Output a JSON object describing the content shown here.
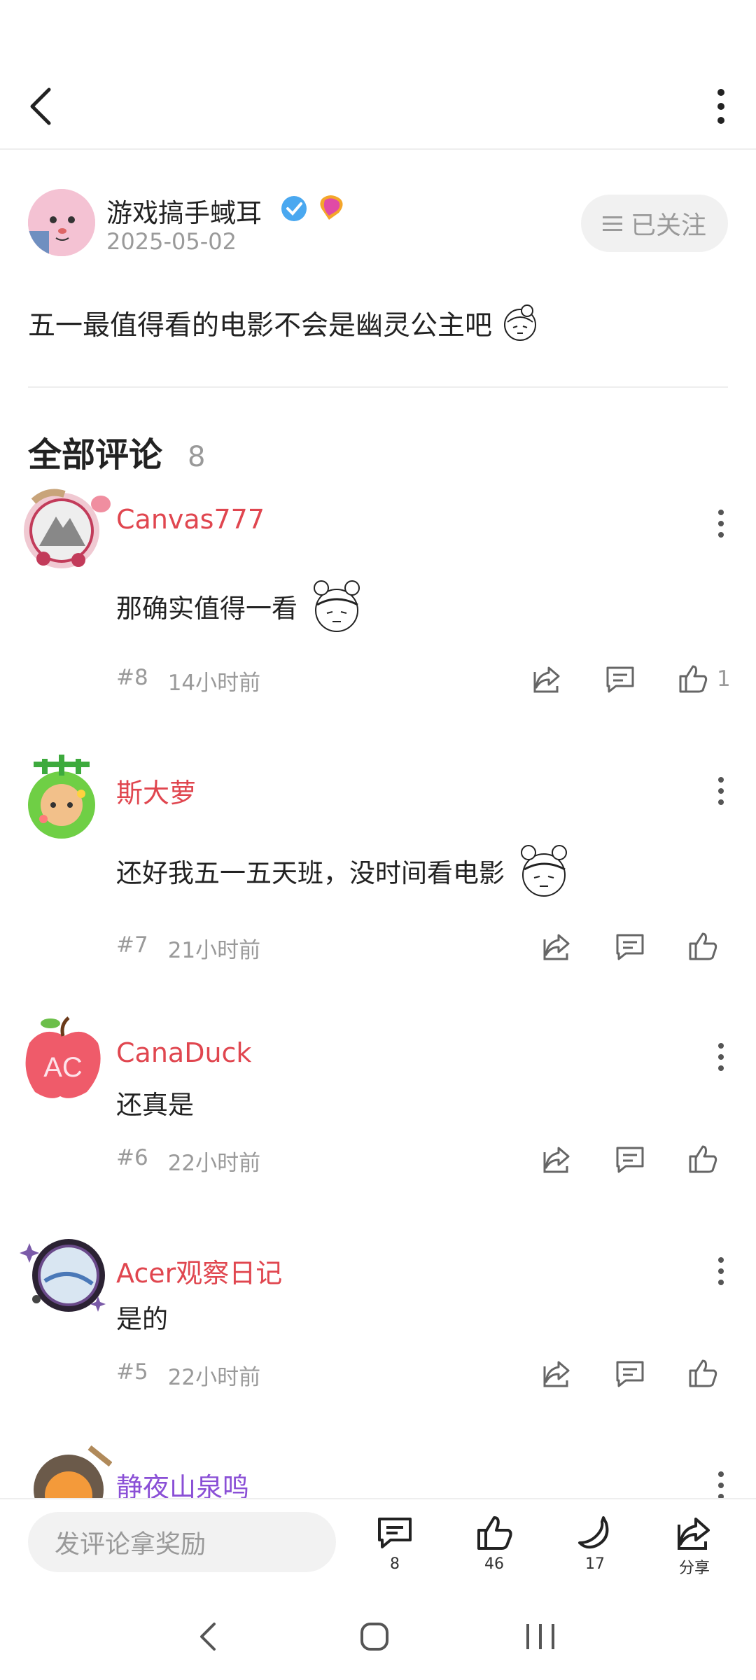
{
  "post": {
    "author_name": "游戏搞手蜮耳",
    "date": "2025-05-02",
    "follow_label": "已关注",
    "text": "五一最值得看的电影不会是幽灵公主吧"
  },
  "comments_section": {
    "title": "全部评论",
    "count": "8"
  },
  "comments": [
    {
      "name": "Canvas777",
      "name_color": "#e0464f",
      "text": "那确实值得一看",
      "floor": "#8",
      "time": "14小时前",
      "likes": "1"
    },
    {
      "name": "斯大萝",
      "name_color": "#e0464f",
      "text": "还好我五一五天班，没时间看电影",
      "floor": "#7",
      "time": "21小时前",
      "likes": ""
    },
    {
      "name": "CanaDuck",
      "name_color": "#e0464f",
      "text": "还真是",
      "floor": "#6",
      "time": "22小时前",
      "likes": ""
    },
    {
      "name": "Acer观察日记",
      "name_color": "#e0464f",
      "text": "是的",
      "floor": "#5",
      "time": "22小时前",
      "likes": ""
    },
    {
      "name": "静夜山泉鸣",
      "name_color": "#8a4fd6",
      "text": "",
      "floor": "",
      "time": "",
      "likes": ""
    }
  ],
  "bottom_bar": {
    "input_placeholder": "发评论拿奖励",
    "comments_count": "8",
    "likes_count": "46",
    "favorites_count": "17",
    "share_label": "分享"
  }
}
